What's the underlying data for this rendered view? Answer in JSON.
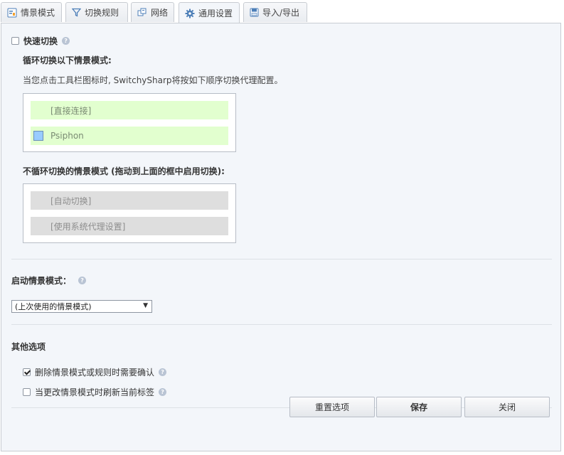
{
  "tabs": [
    {
      "label": "情景模式",
      "icon": "profiles-icon"
    },
    {
      "label": "切换规则",
      "icon": "filter-icon"
    },
    {
      "label": "网络",
      "icon": "network-icon"
    },
    {
      "label": "通用设置",
      "icon": "gear-icon",
      "active": true
    },
    {
      "label": "导入/导出",
      "icon": "floppy-disk-icon"
    }
  ],
  "quick_switch": {
    "label": "快速切换",
    "checked": false,
    "cycle_heading": "循环切换以下情景模式:",
    "description": "当您点击工具栏图标时, SwitchySharp将按如下顺序切换代理配置。",
    "cycle_items": [
      "[直接连接]",
      "Psiphon"
    ],
    "psiphon_color": "#99ccff",
    "noncycle_heading": "不循环切换的情景模式 (拖动到上面的框中启用切换):",
    "noncycle_items": [
      "[自动切换]",
      "[使用系统代理设置]"
    ]
  },
  "startup": {
    "label": "启动情景模式：",
    "selected": "(上次使用的情景模式)"
  },
  "other": {
    "heading": "其他选项",
    "options": [
      {
        "label": "删除情景模式或规则时需要确认",
        "checked": true
      },
      {
        "label": "当更改情景模式时刷新当前标签",
        "checked": false
      }
    ]
  },
  "buttons": {
    "reset": "重置选项",
    "save": "保存",
    "close": "关闭"
  },
  "help_glyph": "?",
  "colors": {
    "accent_blue": "#4d7fb8",
    "cycle_bg": "#e2ffcf",
    "noncycle_bg": "#dedede"
  }
}
